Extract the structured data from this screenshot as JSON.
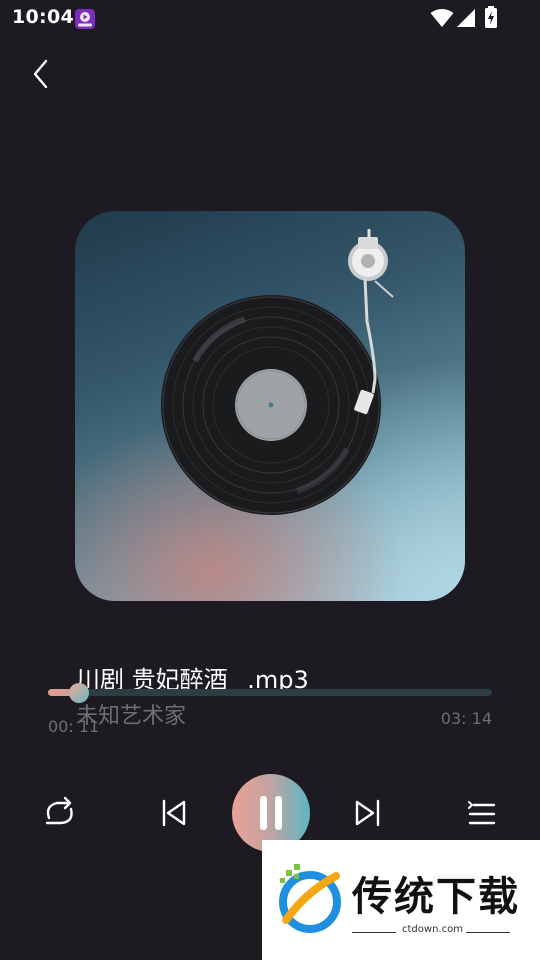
{
  "status_bar": {
    "time": "10:04",
    "icons": [
      "app-notification-icon",
      "wifi-icon",
      "signal-icon",
      "battery-charging-icon"
    ]
  },
  "nav": {
    "back_icon": "chevron-left-icon"
  },
  "track": {
    "title": "川剧 贵妃醉酒_ .mp3",
    "artist": "未知艺术家",
    "current_time": "00: 11",
    "total_time": "03: 14",
    "progress_fraction": 0.057
  },
  "controls": {
    "repeat_icon": "repeat-icon",
    "previous_icon": "skip-previous-icon",
    "play_pause_icon": "pause-icon",
    "next_icon": "skip-next-icon",
    "playlist_icon": "playlist-icon"
  },
  "colors": {
    "background": "#1d1b21",
    "accent_start": "#e9a194",
    "accent_end": "#5fb6c3",
    "muted_text": "#6e6c74"
  },
  "watermark": {
    "title": "传统下载",
    "url": "ctdown.com"
  }
}
